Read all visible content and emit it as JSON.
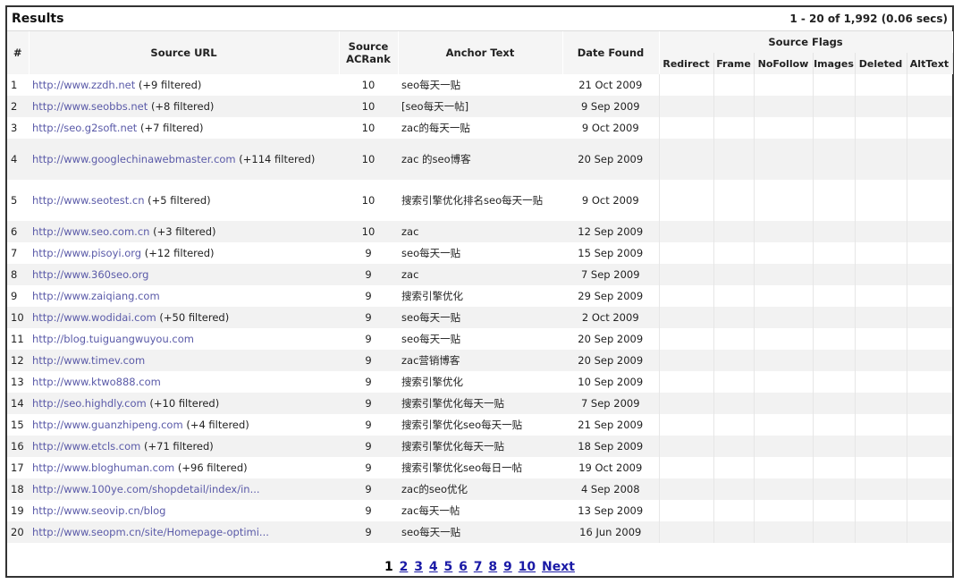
{
  "header": {
    "title": "Results",
    "count": "1 - 20 of 1,992 (0.06 secs)"
  },
  "columns": {
    "num": "#",
    "source_url": "Source URL",
    "source_acrank": [
      "Source",
      "ACRank"
    ],
    "anchor_text": "Anchor Text",
    "date_found": "Date Found",
    "source_flags": "Source Flags",
    "flags": [
      "Redirect",
      "Frame",
      "NoFollow",
      "Images",
      "Deleted",
      "AltText"
    ]
  },
  "rows": [
    {
      "num": "1",
      "url": "http://www.zzdh.net",
      "filtered": "(+9 filtered)",
      "rank": "10",
      "anchor": "seo每天一贴",
      "date": "21 Oct 2009"
    },
    {
      "num": "2",
      "url": "http://www.seobbs.net",
      "filtered": "(+8 filtered)",
      "rank": "10",
      "anchor": "[seo每天一帖]",
      "date": "9 Sep 2009"
    },
    {
      "num": "3",
      "url": "http://seo.g2soft.net",
      "filtered": "(+7 filtered)",
      "rank": "10",
      "anchor": "zac的每天一贴",
      "date": "9 Oct 2009"
    },
    {
      "num": "4",
      "url": "http://www.googlechinawebmaster.com",
      "filtered": "(+114 filtered)",
      "rank": "10",
      "anchor": "zac 的seo博客",
      "date": "20 Sep 2009",
      "tall": true
    },
    {
      "num": "5",
      "url": "http://www.seotest.cn",
      "filtered": "(+5 filtered)",
      "rank": "10",
      "anchor": "搜索引擎优化排名seo每天一贴",
      "date": "9 Oct 2009",
      "tall": true
    },
    {
      "num": "6",
      "url": "http://www.seo.com.cn",
      "filtered": "(+3 filtered)",
      "rank": "10",
      "anchor": "zac",
      "date": "12 Sep 2009"
    },
    {
      "num": "7",
      "url": "http://www.pisoyi.org",
      "filtered": "(+12 filtered)",
      "rank": "9",
      "anchor": "seo每天一贴",
      "date": "15 Sep 2009"
    },
    {
      "num": "8",
      "url": "http://www.360seo.org",
      "filtered": "",
      "rank": "9",
      "anchor": "zac",
      "date": "7 Sep 2009"
    },
    {
      "num": "9",
      "url": "http://www.zaiqiang.com",
      "filtered": "",
      "rank": "9",
      "anchor": "搜索引擎优化",
      "date": "29 Sep 2009"
    },
    {
      "num": "10",
      "url": "http://www.wodidai.com",
      "filtered": "(+50 filtered)",
      "rank": "9",
      "anchor": "seo每天一贴",
      "date": "2 Oct 2009"
    },
    {
      "num": "11",
      "url": "http://blog.tuiguangwuyou.com",
      "filtered": "",
      "rank": "9",
      "anchor": "seo每天一贴",
      "date": "20 Sep 2009"
    },
    {
      "num": "12",
      "url": "http://www.timev.com",
      "filtered": "",
      "rank": "9",
      "anchor": "zac营销博客",
      "date": "20 Sep 2009"
    },
    {
      "num": "13",
      "url": "http://www.ktwo888.com",
      "filtered": "",
      "rank": "9",
      "anchor": "搜索引擎优化",
      "date": "10 Sep 2009"
    },
    {
      "num": "14",
      "url": "http://seo.highdly.com",
      "filtered": "(+10 filtered)",
      "rank": "9",
      "anchor": "搜索引擎优化每天一贴",
      "date": "7 Sep 2009"
    },
    {
      "num": "15",
      "url": "http://www.guanzhipeng.com",
      "filtered": "(+4 filtered)",
      "rank": "9",
      "anchor": "搜索引擎优化seo每天一贴",
      "date": "21 Sep 2009"
    },
    {
      "num": "16",
      "url": "http://www.etcls.com",
      "filtered": "(+71 filtered)",
      "rank": "9",
      "anchor": "搜索引擎优化每天一贴",
      "date": "18 Sep 2009"
    },
    {
      "num": "17",
      "url": "http://www.bloghuman.com",
      "filtered": "(+96 filtered)",
      "rank": "9",
      "anchor": "搜索引擎优化seo每日一帖",
      "date": "19 Oct 2009"
    },
    {
      "num": "18",
      "url": "http://www.100ye.com/shopdetail/index/in...",
      "filtered": "",
      "rank": "9",
      "anchor": "zac的seo优化",
      "date": "4 Sep 2008"
    },
    {
      "num": "19",
      "url": "http://www.seovip.cn/blog",
      "filtered": "",
      "rank": "9",
      "anchor": "zac每天一帖",
      "date": "13 Sep 2009"
    },
    {
      "num": "20",
      "url": "http://www.seopm.cn/site/Homepage-optimi...",
      "filtered": "",
      "rank": "9",
      "anchor": "seo每天一贴",
      "date": "16 Jun 2009"
    }
  ],
  "pagination": {
    "current": "1",
    "pages": [
      "2",
      "3",
      "4",
      "5",
      "6",
      "7",
      "8",
      "9",
      "10"
    ],
    "next": "Next"
  }
}
